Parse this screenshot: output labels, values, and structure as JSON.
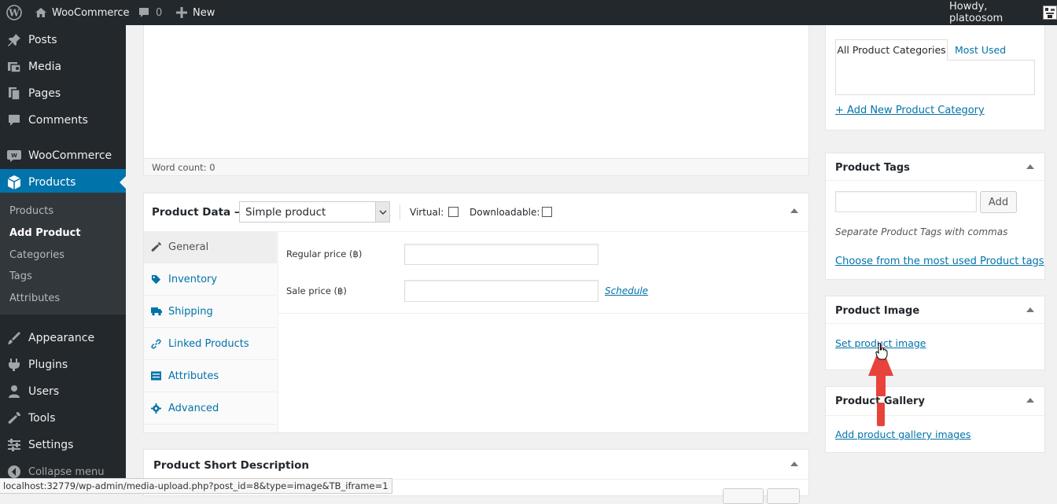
{
  "adminbar": {
    "site_name": "WooCommerce",
    "comments_count": "0",
    "new_label": "New",
    "howdy": "Howdy, platoosom"
  },
  "sidebar": {
    "items": [
      {
        "label": "Posts",
        "icon": "pin-icon"
      },
      {
        "label": "Media",
        "icon": "media-icon"
      },
      {
        "label": "Pages",
        "icon": "pages-icon"
      },
      {
        "label": "Comments",
        "icon": "comments-icon"
      },
      {
        "label": "WooCommerce",
        "icon": "woocommerce-icon"
      },
      {
        "label": "Products",
        "icon": "products-icon"
      },
      {
        "label": "Appearance",
        "icon": "appearance-icon"
      },
      {
        "label": "Plugins",
        "icon": "plugins-icon"
      },
      {
        "label": "Users",
        "icon": "users-icon"
      },
      {
        "label": "Tools",
        "icon": "tools-icon"
      },
      {
        "label": "Settings",
        "icon": "settings-icon"
      },
      {
        "label": "Collapse menu",
        "icon": "collapse-icon"
      }
    ],
    "submenu": [
      "Products",
      "Add Product",
      "Categories",
      "Tags",
      "Attributes"
    ]
  },
  "editor": {
    "word_count": "Word count: 0"
  },
  "product_data": {
    "title": "Product Data —",
    "type_selected": "Simple product",
    "virtual_label": "Virtual:",
    "downloadable_label": "Downloadable:",
    "tabs": [
      "General",
      "Inventory",
      "Shipping",
      "Linked Products",
      "Attributes",
      "Advanced"
    ],
    "regular_price_label": "Regular price (฿)",
    "sale_price_label": "Sale price (฿)",
    "schedule_link": "Schedule"
  },
  "short_description": {
    "title": "Product Short Description"
  },
  "categories": {
    "tab_all": "All Product Categories",
    "tab_most_used": "Most Used",
    "add_new": "+ Add New Product Category"
  },
  "tags": {
    "title": "Product Tags",
    "add_button": "Add",
    "hint": "Separate Product Tags with commas",
    "choose_link": "Choose from the most used Product tags"
  },
  "product_image": {
    "title": "Product Image",
    "set_link": "Set product image"
  },
  "product_gallery": {
    "title": "Product Gallery",
    "add_link": "Add product gallery images"
  },
  "statusbar": {
    "url": "localhost:32779/wp-admin/media-upload.php?post_id=8&type=image&TB_iframe=1"
  },
  "colors": {
    "admin_dark": "#23282d",
    "accent_blue": "#0073aa",
    "arrow_red": "#e8433b"
  }
}
